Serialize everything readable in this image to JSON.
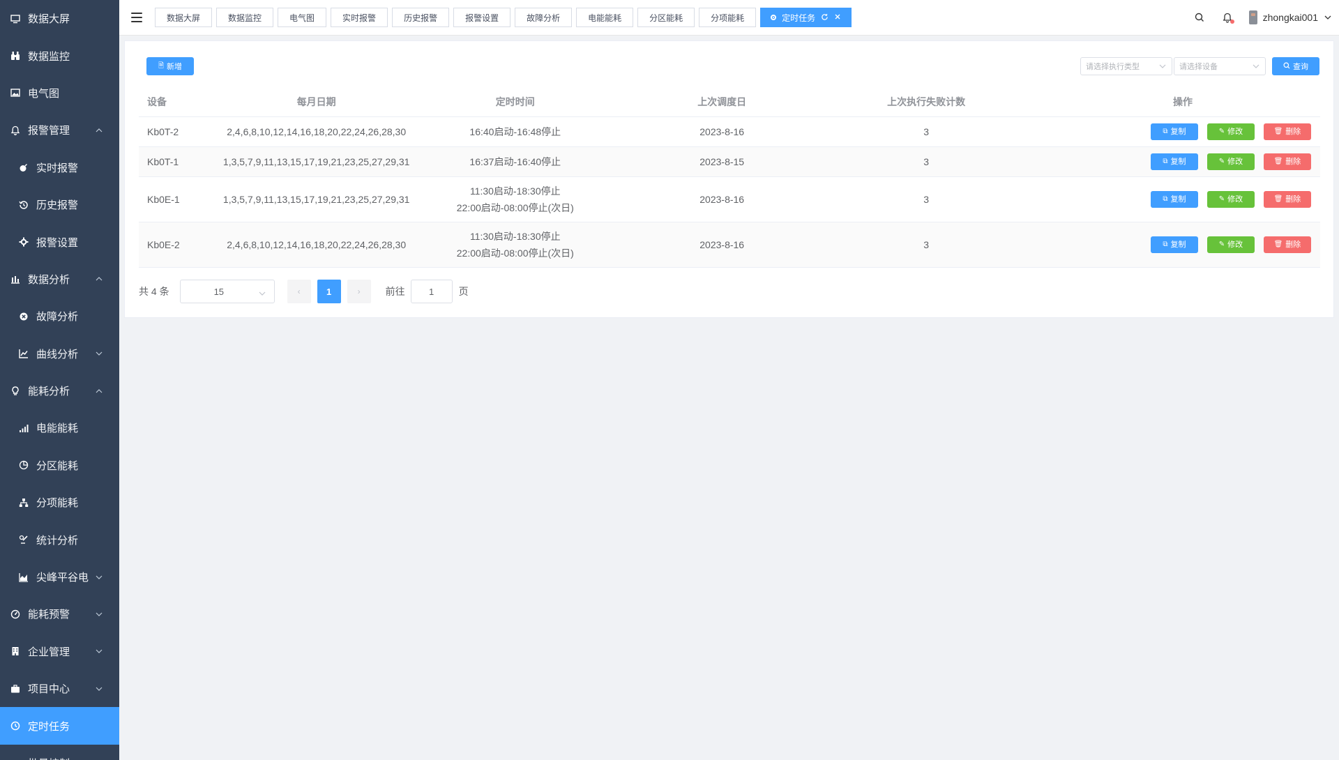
{
  "sidebar": {
    "items": [
      {
        "label": "数据大屏",
        "icon": "monitor-icon",
        "level": "top",
        "arrow": ""
      },
      {
        "label": "数据监控",
        "icon": "binoculars-icon",
        "level": "top",
        "arrow": ""
      },
      {
        "label": "电气图",
        "icon": "image-icon",
        "level": "top",
        "arrow": ""
      },
      {
        "label": "报警管理",
        "icon": "bell-icon",
        "level": "top",
        "arrow": "up"
      },
      {
        "label": "实时报警",
        "icon": "bomb-icon",
        "level": "sub",
        "arrow": ""
      },
      {
        "label": "历史报警",
        "icon": "history-icon",
        "level": "sub",
        "arrow": ""
      },
      {
        "label": "报警设置",
        "icon": "gear-icon",
        "level": "sub",
        "arrow": ""
      },
      {
        "label": "数据分析",
        "icon": "bar-chart-icon",
        "level": "top",
        "arrow": "up"
      },
      {
        "label": "故障分析",
        "icon": "close-circle-icon",
        "level": "sub",
        "arrow": ""
      },
      {
        "label": "曲线分析",
        "icon": "line-chart-icon",
        "level": "sub",
        "arrow": "down"
      },
      {
        "label": "能耗分析",
        "icon": "lightbulb-icon",
        "level": "top",
        "arrow": "up"
      },
      {
        "label": "电能能耗",
        "icon": "signal-icon",
        "level": "sub",
        "arrow": ""
      },
      {
        "label": "分区能耗",
        "icon": "pie-chart-icon",
        "level": "sub",
        "arrow": ""
      },
      {
        "label": "分项能耗",
        "icon": "sitemap-icon",
        "level": "sub",
        "arrow": ""
      },
      {
        "label": "统计分析",
        "icon": "chart-pen-icon",
        "level": "sub",
        "arrow": ""
      },
      {
        "label": "尖峰平谷电",
        "icon": "area-chart-icon",
        "level": "sub",
        "arrow": "down"
      },
      {
        "label": "能耗预警",
        "icon": "dashboard-icon",
        "level": "top",
        "arrow": "down"
      },
      {
        "label": "企业管理",
        "icon": "building-icon",
        "level": "top",
        "arrow": "down"
      },
      {
        "label": "项目中心",
        "icon": "briefcase-icon",
        "level": "top",
        "arrow": "down"
      },
      {
        "label": "定时任务",
        "icon": "clock-icon",
        "level": "top",
        "arrow": "",
        "active": true
      },
      {
        "label": "批量控制",
        "icon": "sliders-icon",
        "level": "top",
        "arrow": ""
      }
    ]
  },
  "header": {
    "tabs": [
      {
        "label": "数据大屏"
      },
      {
        "label": "数据监控"
      },
      {
        "label": "电气图"
      },
      {
        "label": "实时报警"
      },
      {
        "label": "历史报警"
      },
      {
        "label": "报警设置"
      },
      {
        "label": "故障分析"
      },
      {
        "label": "电能能耗"
      },
      {
        "label": "分区能耗"
      },
      {
        "label": "分项能耗"
      },
      {
        "label": "定时任务",
        "active": true
      }
    ],
    "username": "zhongkai001"
  },
  "toolbar": {
    "add_label": "新增",
    "exec_type_placeholder": "请选择执行类型",
    "device_placeholder": "请选择设备",
    "search_label": "查询"
  },
  "table": {
    "columns": [
      "设备",
      "每月日期",
      "定时时间",
      "上次调度日",
      "上次执行失败计数",
      "操作"
    ],
    "rows": [
      {
        "device": "Kb0T-2",
        "dates": "2,4,6,8,10,12,14,16,18,20,22,24,26,28,30",
        "time_lines": [
          "16:40启动-16:48停止"
        ],
        "last_date": "2023-8-16",
        "fail_count": "3"
      },
      {
        "device": "Kb0T-1",
        "dates": "1,3,5,7,9,11,13,15,17,19,21,23,25,27,29,31",
        "time_lines": [
          "16:37启动-16:40停止"
        ],
        "last_date": "2023-8-15",
        "fail_count": "3"
      },
      {
        "device": "Kb0E-1",
        "dates": "1,3,5,7,9,11,13,15,17,19,21,23,25,27,29,31",
        "time_lines": [
          "11:30启动-18:30停止",
          "22:00启动-08:00停止(次日)"
        ],
        "last_date": "2023-8-16",
        "fail_count": "3"
      },
      {
        "device": "Kb0E-2",
        "dates": "2,4,6,8,10,12,14,16,18,20,22,24,26,28,30",
        "time_lines": [
          "11:30启动-18:30停止",
          "22:00启动-08:00停止(次日)"
        ],
        "last_date": "2023-8-16",
        "fail_count": "3"
      }
    ],
    "actions": {
      "copy": "复制",
      "edit": "修改",
      "delete": "删除"
    }
  },
  "pagination": {
    "total_text": "共 4 条",
    "page_size": "15",
    "current_page": "1",
    "goto_label": "前往",
    "goto_value": "1",
    "page_unit": "页"
  },
  "colors": {
    "sidebar_bg": "#324157",
    "accent": "#409eff",
    "success": "#67c23a",
    "danger": "#f56c6c"
  }
}
